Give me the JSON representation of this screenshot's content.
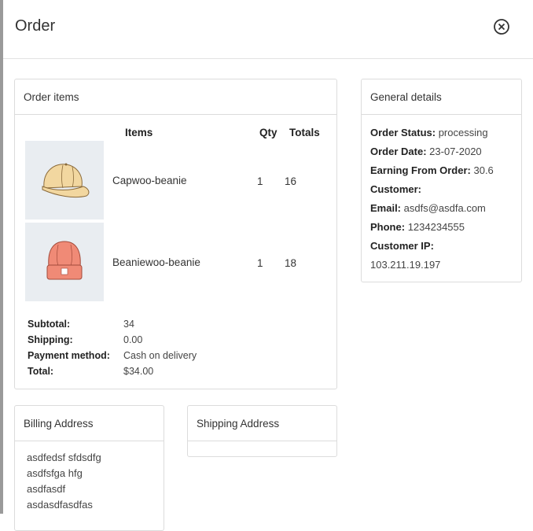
{
  "modal": {
    "title": "Order"
  },
  "order_items": {
    "header": "Order items",
    "columns": {
      "items": "Items",
      "qty": "Qty",
      "totals": "Totals"
    },
    "products": [
      {
        "name": "Capwoo-beanie",
        "qty": "1",
        "total": "16",
        "icon": "cap-icon"
      },
      {
        "name": "Beaniewoo-beanie",
        "qty": "1",
        "total": "18",
        "icon": "beanie-icon"
      }
    ],
    "summary": {
      "subtotal_label": "Subtotal:",
      "subtotal": "34",
      "shipping_label": "Shipping:",
      "shipping": "0.00",
      "payment_label": "Payment method:",
      "payment": "Cash on delivery",
      "total_label": "Total:",
      "total": "$34.00"
    }
  },
  "general_details": {
    "header": "General details",
    "status_label": "Order Status:",
    "status": "processing",
    "date_label": "Order Date:",
    "date": "23-07-2020",
    "earning_label": "Earning From Order:",
    "earning": "30.6",
    "customer_label": "Customer:",
    "email_label": "Email:",
    "email": "asdfs@asdfa.com",
    "phone_label": "Phone:",
    "phone": "1234234555",
    "ip_label": "Customer IP:",
    "ip": "103.211.19.197"
  },
  "billing": {
    "header": "Billing Address",
    "lines": [
      "asdfedsf sfdsdfg",
      "asdfsfga hfg",
      "asdfasdf",
      "asdasdfasdfas"
    ]
  },
  "shipping": {
    "header": "Shipping Address"
  }
}
